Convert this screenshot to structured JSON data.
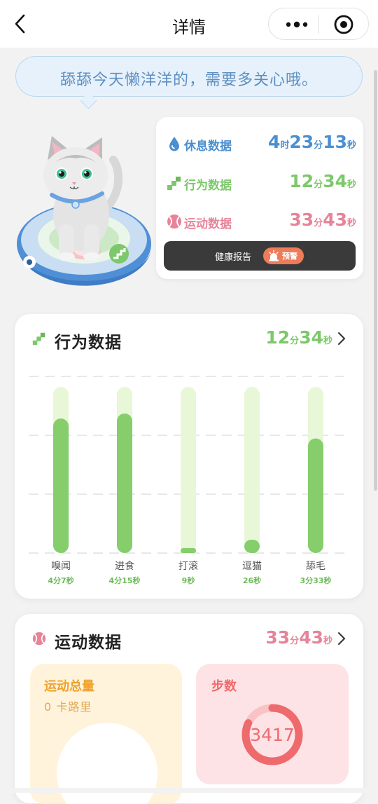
{
  "nav": {
    "title": "详情"
  },
  "bubble": {
    "text": "舔舔今天懒洋洋的，需要多关心哦。"
  },
  "stats": {
    "rest": {
      "label": "休息数据",
      "h": "4",
      "h_unit": "时",
      "m": "23",
      "m_unit": "分",
      "s": "13",
      "s_unit": "秒"
    },
    "behavior": {
      "label": "行为数据",
      "m": "12",
      "m_unit": "分",
      "s": "34",
      "s_unit": "秒"
    },
    "sport": {
      "label": "运动数据",
      "m": "33",
      "m_unit": "分",
      "s": "43",
      "s_unit": "秒"
    },
    "health_button": {
      "label": "健康报告",
      "badge": "预警"
    }
  },
  "behavior_card": {
    "title": "行为数据",
    "total": {
      "m": "12",
      "m_unit": "分",
      "s": "34",
      "s_unit": "秒"
    },
    "chart_data": {
      "type": "bar",
      "categories": [
        "嗅闻",
        "进食",
        "打滚",
        "逗猫",
        "舔毛"
      ],
      "value_labels": [
        "4分7秒",
        "4分15秒",
        "9秒",
        "26秒",
        "3分33秒"
      ],
      "values_seconds": [
        247,
        255,
        9,
        26,
        213
      ],
      "fill_fraction": [
        0.81,
        0.84,
        0.03,
        0.08,
        0.69
      ],
      "colors": {
        "track": "#e8f7d7",
        "fill": "#86cd6c",
        "grid": "#d0d0d0"
      },
      "grid": true
    }
  },
  "sport_card": {
    "title": "运动数据",
    "total": {
      "m": "33",
      "m_unit": "分",
      "s": "43",
      "s_unit": "秒"
    },
    "calories": {
      "title": "运动总量",
      "value": "0 卡路里"
    },
    "steps": {
      "title": "步数",
      "value": "3417",
      "ring_fraction": 0.82
    }
  },
  "colors": {
    "blue": "#4b8fd0",
    "green": "#7cc86a",
    "pink": "#e6849a",
    "orange": "#f0a12b",
    "red": "#ee6a6d"
  }
}
